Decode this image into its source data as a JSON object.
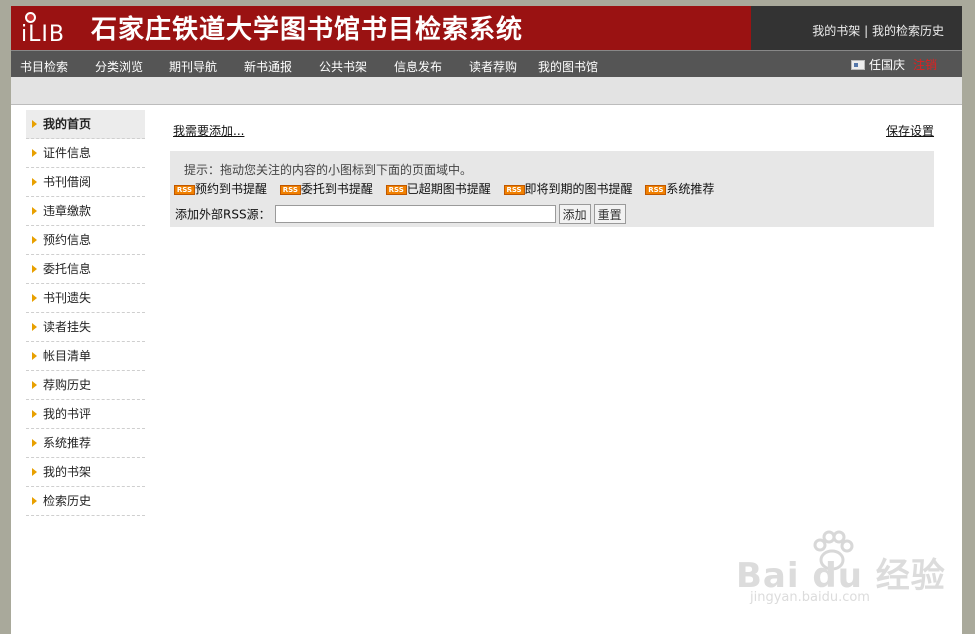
{
  "header": {
    "logo_text": "iLIB",
    "title": "石家庄铁道大学图书馆书目检索系统",
    "link_bookshelf": "我的书架",
    "separator": " | ",
    "link_search_history": "我的检索历史"
  },
  "nav": {
    "items": [
      {
        "label": "书目检索"
      },
      {
        "label": "分类浏览"
      },
      {
        "label": "期刊导航"
      },
      {
        "label": "新书通报"
      },
      {
        "label": "公共书架"
      },
      {
        "label": "信息发布"
      },
      {
        "label": "读者荐购"
      },
      {
        "label": "我的图书馆"
      }
    ],
    "user_name": "任国庆",
    "logout": "注销"
  },
  "sidebar": {
    "items": [
      {
        "label": "我的首页",
        "active": true
      },
      {
        "label": "证件信息"
      },
      {
        "label": "书刊借阅"
      },
      {
        "label": "违章缴款"
      },
      {
        "label": "预约信息"
      },
      {
        "label": "委托信息"
      },
      {
        "label": "书刊遗失"
      },
      {
        "label": "读者挂失"
      },
      {
        "label": "帐目清单"
      },
      {
        "label": "荐购历史"
      },
      {
        "label": "我的书评"
      },
      {
        "label": "系统推荐"
      },
      {
        "label": "我的书架"
      },
      {
        "label": "检索历史"
      }
    ]
  },
  "main": {
    "need_add": "我需要添加...",
    "save_settings": "保存设置",
    "hint": "提示：拖动您关注的内容的小图标到下面的页面域中。",
    "rss_icon_text": "RSS",
    "rss_items": [
      {
        "label": "预约到书提醒"
      },
      {
        "label": "委托到书提醒"
      },
      {
        "label": "已超期图书提醒"
      },
      {
        "label": "即将到期的图书提醒"
      },
      {
        "label": "系统推荐"
      }
    ],
    "rss_source_label": "添加外部RSS源：",
    "rss_source_value": "",
    "add_button": "添加",
    "reset_button": "重置"
  },
  "watermark": {
    "text": "Bai du 经验",
    "url": "jingyan.baidu.com"
  },
  "colors": {
    "brand_red": "#9a1212",
    "nav_bg": "#555555",
    "logout_red": "#e02020",
    "rss_orange": "#f08000",
    "arrow_orange": "#e8a000"
  }
}
